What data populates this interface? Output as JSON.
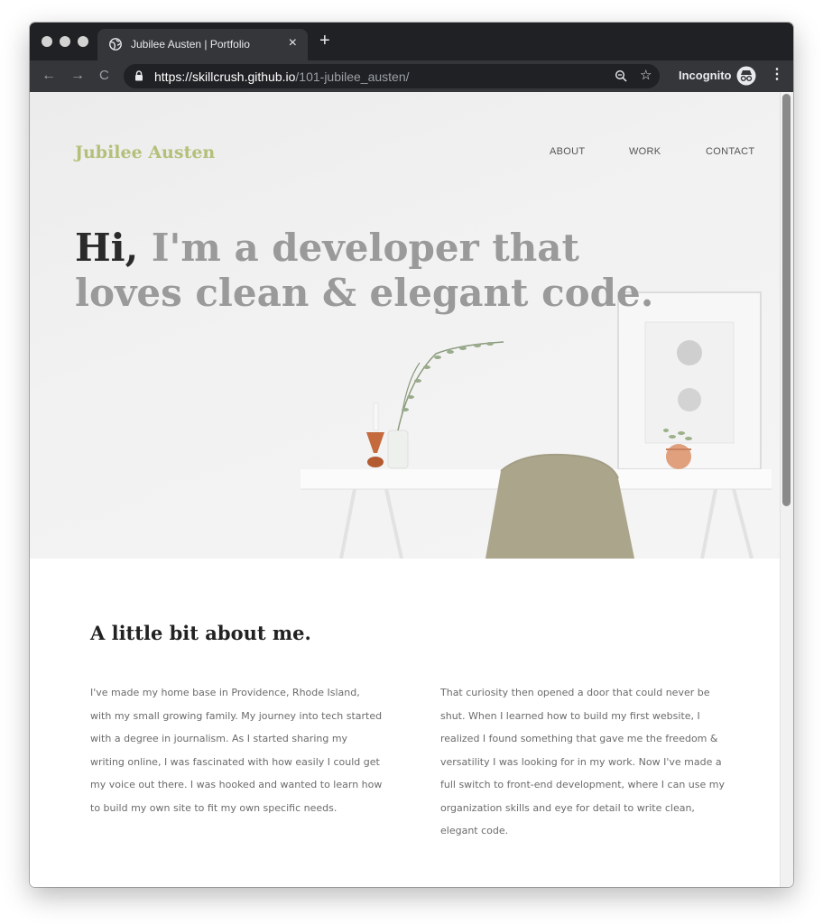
{
  "browser": {
    "tab_title": "Jubilee Austen | Portfolio",
    "tab_close": "×",
    "new_tab": "+",
    "url_host": "https://skillcrush.github.io",
    "url_path": "/101-jubilee_austen/",
    "profile_label": "Incognito",
    "star": "☆",
    "menu": "⋮",
    "back": "←",
    "forward": "→",
    "reload": "C"
  },
  "site": {
    "logo": "Jubilee Austen",
    "nav": [
      "ABOUT",
      "WORK",
      "CONTACT"
    ],
    "headline_strong": "Hi,",
    "headline_rest": " I'm a developer that loves clean & elegant code."
  },
  "about": {
    "heading": "A little bit about me.",
    "paragraphs": [
      "I've made my home base in Providence, Rhode Island, with my small growing family. My journey into tech started with a degree in journalism. As I started sharing my writing online, I was fascinated with how easily I could get my voice out there. I was hooked and wanted to learn how to build my own site to fit my own specific needs.",
      "That curiosity then opened a door that could never be shut. When I learned how to build my first website, I realized I found something that gave me the freedom & versatility I was looking for in my work. Now I've made a full switch to front-end development, where I can use my organization skills and eye for detail to write clean, elegant code."
    ]
  },
  "colors": {
    "accent": "#b4c07a",
    "headline_gray": "#9a9a9a",
    "chrome_dark": "#202124",
    "chrome_tab": "#35363a"
  }
}
